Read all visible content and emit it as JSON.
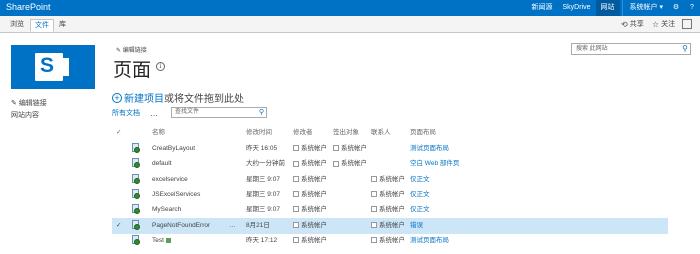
{
  "suite_bar": {
    "brand": "SharePoint",
    "links": [
      "新闻源",
      "SkyDrive",
      "网站"
    ],
    "user": "系统帐户 ▾",
    "gear_icon": "gear-icon",
    "help_icon": "help-icon"
  },
  "ribbon": {
    "tabs": [
      "浏览",
      "文件",
      "库"
    ],
    "selected_tab": "文件",
    "share": "共享",
    "follow": "关注"
  },
  "header": {
    "edit_links": "编辑链接",
    "page_title": "页面",
    "search_placeholder": "搜索 此网站"
  },
  "left_nav": {
    "edit_links": "编辑链接",
    "items": [
      "网站内容"
    ]
  },
  "library": {
    "new_item": "新建项目",
    "new_item_rest": "或将文件拖到此处",
    "all_docs": "所有文档",
    "more": "…",
    "find_placeholder": "查找文件"
  },
  "columns": {
    "name": "名称",
    "modified": "修改时间",
    "modified_by": "修改者",
    "checked_out_to": "签出对象",
    "contact": "联系人",
    "page_layout": "页面布局"
  },
  "rows": [
    {
      "name": "CreatByLayout",
      "modified": "昨天 16:05",
      "modified_by": "系统帐户",
      "checked_out_to": "系统帐户",
      "contact": "",
      "layout": "测试页面布局",
      "selected": false,
      "has_dots": false,
      "new": false
    },
    {
      "name": "default",
      "modified": "大约一分钟前",
      "modified_by": "系统帐户",
      "checked_out_to": "系统帐户",
      "contact": "",
      "layout": "空白 Web 部件页",
      "selected": false,
      "has_dots": false,
      "new": false
    },
    {
      "name": "excelservice",
      "modified": "星期三 9:07",
      "modified_by": "系统帐户",
      "checked_out_to": "",
      "contact": "系统帐户",
      "layout": "仅正文",
      "selected": false,
      "has_dots": false,
      "new": false
    },
    {
      "name": "JSExcelServices",
      "modified": "星期三 9:07",
      "modified_by": "系统帐户",
      "checked_out_to": "",
      "contact": "系统帐户",
      "layout": "仅正文",
      "selected": false,
      "has_dots": false,
      "new": false
    },
    {
      "name": "MySearch",
      "modified": "星期三 9:07",
      "modified_by": "系统帐户",
      "checked_out_to": "",
      "contact": "系统帐户",
      "layout": "仅正文",
      "selected": false,
      "has_dots": false,
      "new": false
    },
    {
      "name": "PageNotFoundError",
      "modified": "8月21日",
      "modified_by": "系统帐户",
      "checked_out_to": "",
      "contact": "系统帐户",
      "layout": "错误",
      "selected": true,
      "has_dots": true,
      "new": false
    },
    {
      "name": "Test",
      "modified": "昨天 17:12",
      "modified_by": "系统帐户",
      "checked_out_to": "",
      "contact": "系统帐户",
      "layout": "测试页面布局",
      "selected": false,
      "has_dots": false,
      "new": true
    }
  ],
  "colors": {
    "suite_bar": "#0072c6",
    "link": "#0072c6",
    "selected_row": "#cde6f7"
  }
}
